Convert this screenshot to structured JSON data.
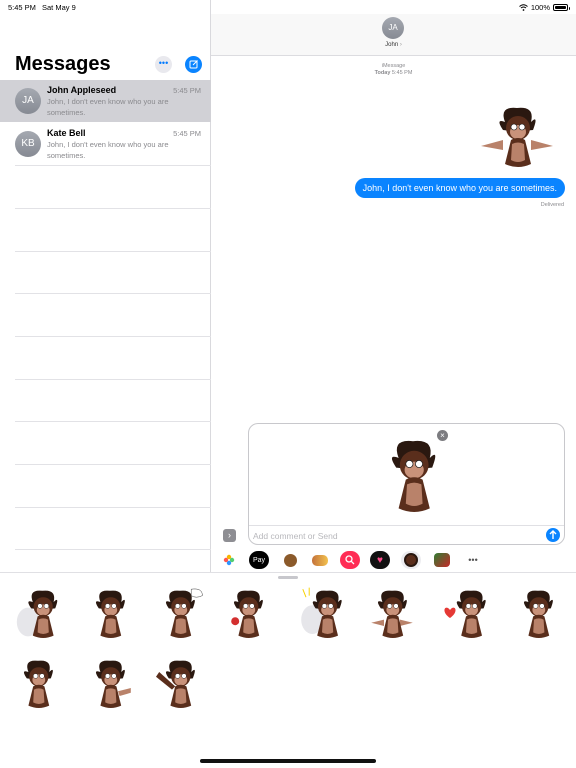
{
  "status_bar": {
    "time": "5:45 PM",
    "date": "Sat May 9",
    "battery": "100%",
    "battery_level": 1.0
  },
  "sidebar": {
    "title": "Messages",
    "more_icon": "ellipsis-icon",
    "compose_icon": "compose-icon",
    "conversations": [
      {
        "initials": "JA",
        "name": "John Appleseed",
        "time": "5:45 PM",
        "preview": "John, I don't even know who you are sometimes.",
        "selected": true
      },
      {
        "initials": "KB",
        "name": "Kate Bell",
        "time": "5:45 PM",
        "preview": "John, I don't even know who you are sometimes.",
        "selected": false
      }
    ]
  },
  "conversation": {
    "contact_initials": "JA",
    "contact_name": "John",
    "service": "iMessage",
    "day": "Today",
    "stamp_time": "5:45 PM",
    "message": "John, I don't even know who you are sometimes.",
    "status": "Delivered"
  },
  "compose": {
    "placeholder": "Add comment or Send"
  },
  "app_strip": [
    "photos-icon",
    "apple-pay-icon",
    "monkey-emoji-icon",
    "sticker-app-icon",
    "image-search-icon",
    "heart-app-icon",
    "monkey-sticker-app-icon",
    "game-app-icon",
    "more-apps-icon"
  ],
  "apple_pay_label": "Pay",
  "colors": {
    "accent": "#0a84ff",
    "fur": "#5a2e1c",
    "skin": "#b9826a"
  }
}
